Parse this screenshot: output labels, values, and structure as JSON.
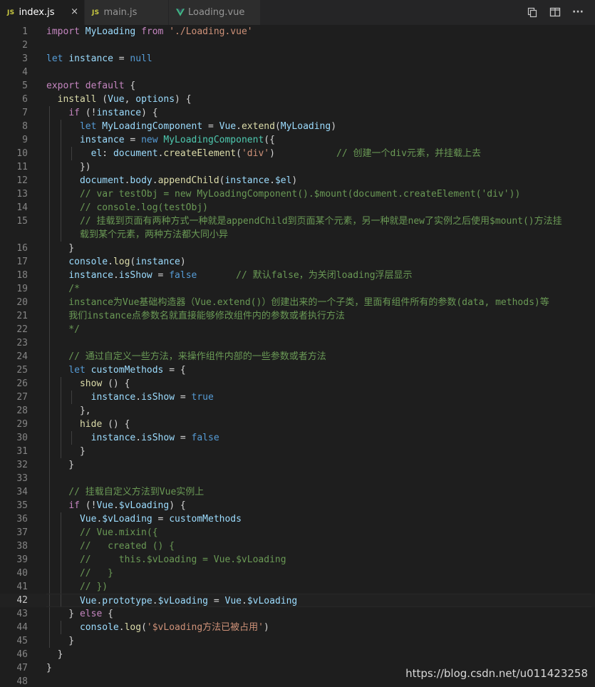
{
  "tabs": [
    {
      "name": "index.js",
      "icon": "js-file-icon",
      "badge": "JS",
      "active": true,
      "close": "×"
    },
    {
      "name": "main.js",
      "icon": "js-file-icon",
      "badge": "JS",
      "active": false
    },
    {
      "name": "Loading.vue",
      "icon": "vue-file-icon",
      "active": false
    }
  ],
  "toolbar": {
    "actions": [
      "open-changes-icon",
      "split-editor-icon",
      "more-actions-icon"
    ],
    "more": "···"
  },
  "editor": {
    "active_line": 42,
    "lines": [
      {
        "n": "1",
        "indent": 0,
        "t": [
          [
            "c",
            "import"
          ],
          [
            "o",
            " "
          ],
          [
            "v",
            "MyLoading"
          ],
          [
            "o",
            " "
          ],
          [
            "c",
            "from"
          ],
          [
            "o",
            " "
          ],
          [
            "s",
            "'./Loading.vue'"
          ]
        ]
      },
      {
        "n": "2",
        "indent": 0,
        "t": []
      },
      {
        "n": "3",
        "indent": 0,
        "t": [
          [
            "k",
            "let"
          ],
          [
            "o",
            " "
          ],
          [
            "v",
            "instance"
          ],
          [
            "o",
            " = "
          ],
          [
            "k",
            "null"
          ]
        ]
      },
      {
        "n": "4",
        "indent": 0,
        "t": []
      },
      {
        "n": "5",
        "indent": 0,
        "t": [
          [
            "c",
            "export"
          ],
          [
            "o",
            " "
          ],
          [
            "c",
            "default"
          ],
          [
            "o",
            " {"
          ]
        ]
      },
      {
        "n": "6",
        "indent": 0,
        "t": [
          [
            "o",
            "  "
          ],
          [
            "f",
            "install"
          ],
          [
            "o",
            " ("
          ],
          [
            "v",
            "Vue"
          ],
          [
            "o",
            ", "
          ],
          [
            "v",
            "options"
          ],
          [
            "o",
            ") {"
          ]
        ]
      },
      {
        "n": "7",
        "indent": 1,
        "t": [
          [
            "o",
            "    "
          ],
          [
            "c",
            "if"
          ],
          [
            "o",
            " (!"
          ],
          [
            "v",
            "instance"
          ],
          [
            "o",
            ") {"
          ]
        ]
      },
      {
        "n": "8",
        "indent": 2,
        "t": [
          [
            "o",
            "      "
          ],
          [
            "k",
            "let"
          ],
          [
            "o",
            " "
          ],
          [
            "v",
            "MyLoadingComponent"
          ],
          [
            "o",
            " = "
          ],
          [
            "v",
            "Vue"
          ],
          [
            "o",
            "."
          ],
          [
            "f",
            "extend"
          ],
          [
            "o",
            "("
          ],
          [
            "v",
            "MyLoading"
          ],
          [
            "o",
            ")"
          ]
        ]
      },
      {
        "n": "9",
        "indent": 2,
        "t": [
          [
            "o",
            "      "
          ],
          [
            "v",
            "instance"
          ],
          [
            "o",
            " = "
          ],
          [
            "k",
            "new"
          ],
          [
            "o",
            " "
          ],
          [
            "t",
            "MyLoadingComponent"
          ],
          [
            "o",
            "({"
          ]
        ]
      },
      {
        "n": "10",
        "indent": 3,
        "t": [
          [
            "o",
            "        "
          ],
          [
            "v",
            "el"
          ],
          [
            "o",
            ": "
          ],
          [
            "v",
            "document"
          ],
          [
            "o",
            "."
          ],
          [
            "f",
            "createElement"
          ],
          [
            "o",
            "("
          ],
          [
            "s",
            "'div'"
          ],
          [
            "o",
            ")"
          ],
          [
            "m",
            "           // 创建一个div元素，并挂载上去"
          ]
        ]
      },
      {
        "n": "11",
        "indent": 2,
        "t": [
          [
            "o",
            "      })"
          ]
        ]
      },
      {
        "n": "12",
        "indent": 2,
        "t": [
          [
            "o",
            "      "
          ],
          [
            "v",
            "document"
          ],
          [
            "o",
            "."
          ],
          [
            "v",
            "body"
          ],
          [
            "o",
            "."
          ],
          [
            "f",
            "appendChild"
          ],
          [
            "o",
            "("
          ],
          [
            "v",
            "instance"
          ],
          [
            "o",
            "."
          ],
          [
            "v",
            "$el"
          ],
          [
            "o",
            ")"
          ]
        ]
      },
      {
        "n": "13",
        "indent": 2,
        "t": [
          [
            "m",
            "      // var testObj = new MyLoadingComponent().$mount(document.createElement('div'))"
          ]
        ]
      },
      {
        "n": "14",
        "indent": 2,
        "t": [
          [
            "m",
            "      // console.log(testObj)"
          ]
        ]
      },
      {
        "n": "15",
        "indent": 2,
        "t": [
          [
            "m",
            "      // 挂载到页面有两种方式一种就是appendChild到页面某个元素，另一种就是new了实例之后使用$mount()方法挂"
          ]
        ]
      },
      {
        "n": "",
        "indent": 2,
        "t": [
          [
            "m",
            "      载到某个元素，两种方法都大同小异"
          ]
        ]
      },
      {
        "n": "16",
        "indent": 1,
        "t": [
          [
            "o",
            "    }"
          ]
        ]
      },
      {
        "n": "17",
        "indent": 1,
        "t": [
          [
            "o",
            "    "
          ],
          [
            "v",
            "console"
          ],
          [
            "o",
            "."
          ],
          [
            "f",
            "log"
          ],
          [
            "o",
            "("
          ],
          [
            "v",
            "instance"
          ],
          [
            "o",
            ")"
          ]
        ]
      },
      {
        "n": "18",
        "indent": 1,
        "t": [
          [
            "o",
            "    "
          ],
          [
            "v",
            "instance"
          ],
          [
            "o",
            "."
          ],
          [
            "v",
            "isShow"
          ],
          [
            "o",
            " = "
          ],
          [
            "k",
            "false"
          ],
          [
            "m",
            "       // 默认false，为关闭loading浮层显示"
          ]
        ]
      },
      {
        "n": "19",
        "indent": 1,
        "t": [
          [
            "m",
            "    /*"
          ]
        ]
      },
      {
        "n": "20",
        "indent": 1,
        "t": [
          [
            "m",
            "    instance为Vue基础构造器（Vue.extend()）创建出来的一个子类，里面有组件所有的参数(data, methods)等"
          ]
        ]
      },
      {
        "n": "21",
        "indent": 1,
        "t": [
          [
            "m",
            "    我们instance点参数名就直接能够修改组件内的参数或者执行方法"
          ]
        ]
      },
      {
        "n": "22",
        "indent": 1,
        "t": [
          [
            "m",
            "    */"
          ]
        ]
      },
      {
        "n": "23",
        "indent": 1,
        "t": []
      },
      {
        "n": "24",
        "indent": 1,
        "t": [
          [
            "m",
            "    // 通过自定义一些方法，来操作组件内部的一些参数或者方法"
          ]
        ]
      },
      {
        "n": "25",
        "indent": 1,
        "t": [
          [
            "o",
            "    "
          ],
          [
            "k",
            "let"
          ],
          [
            "o",
            " "
          ],
          [
            "v",
            "customMethods"
          ],
          [
            "o",
            " = {"
          ]
        ]
      },
      {
        "n": "26",
        "indent": 2,
        "t": [
          [
            "o",
            "      "
          ],
          [
            "f",
            "show"
          ],
          [
            "o",
            " () {"
          ]
        ]
      },
      {
        "n": "27",
        "indent": 3,
        "t": [
          [
            "o",
            "        "
          ],
          [
            "v",
            "instance"
          ],
          [
            "o",
            "."
          ],
          [
            "v",
            "isShow"
          ],
          [
            "o",
            " = "
          ],
          [
            "k",
            "true"
          ]
        ]
      },
      {
        "n": "28",
        "indent": 2,
        "t": [
          [
            "o",
            "      },"
          ]
        ]
      },
      {
        "n": "29",
        "indent": 2,
        "t": [
          [
            "o",
            "      "
          ],
          [
            "f",
            "hide"
          ],
          [
            "o",
            " () {"
          ]
        ]
      },
      {
        "n": "30",
        "indent": 3,
        "t": [
          [
            "o",
            "        "
          ],
          [
            "v",
            "instance"
          ],
          [
            "o",
            "."
          ],
          [
            "v",
            "isShow"
          ],
          [
            "o",
            " = "
          ],
          [
            "k",
            "false"
          ]
        ]
      },
      {
        "n": "31",
        "indent": 2,
        "t": [
          [
            "o",
            "      }"
          ]
        ]
      },
      {
        "n": "32",
        "indent": 1,
        "t": [
          [
            "o",
            "    }"
          ]
        ]
      },
      {
        "n": "33",
        "indent": 1,
        "t": []
      },
      {
        "n": "34",
        "indent": 1,
        "t": [
          [
            "m",
            "    // 挂载自定义方法到Vue实例上"
          ]
        ]
      },
      {
        "n": "35",
        "indent": 1,
        "t": [
          [
            "o",
            "    "
          ],
          [
            "c",
            "if"
          ],
          [
            "o",
            " (!"
          ],
          [
            "v",
            "Vue"
          ],
          [
            "o",
            "."
          ],
          [
            "v",
            "$vLoading"
          ],
          [
            "o",
            ") {"
          ]
        ]
      },
      {
        "n": "36",
        "indent": 2,
        "t": [
          [
            "o",
            "      "
          ],
          [
            "v",
            "Vue"
          ],
          [
            "o",
            "."
          ],
          [
            "v",
            "$vLoading"
          ],
          [
            "o",
            " = "
          ],
          [
            "v",
            "customMethods"
          ]
        ]
      },
      {
        "n": "37",
        "indent": 2,
        "t": [
          [
            "m",
            "      // Vue.mixin({"
          ]
        ]
      },
      {
        "n": "38",
        "indent": 2,
        "t": [
          [
            "m",
            "      //   created () {"
          ]
        ]
      },
      {
        "n": "39",
        "indent": 2,
        "t": [
          [
            "m",
            "      //     this.$vLoading = Vue.$vLoading"
          ]
        ]
      },
      {
        "n": "40",
        "indent": 2,
        "t": [
          [
            "m",
            "      //   }"
          ]
        ]
      },
      {
        "n": "41",
        "indent": 2,
        "t": [
          [
            "m",
            "      // })"
          ]
        ]
      },
      {
        "n": "42",
        "indent": 2,
        "t": [
          [
            "o",
            "      "
          ],
          [
            "v",
            "Vue"
          ],
          [
            "o",
            "."
          ],
          [
            "v",
            "prototype"
          ],
          [
            "o",
            "."
          ],
          [
            "v",
            "$vLoading"
          ],
          [
            "o",
            " = "
          ],
          [
            "v",
            "Vue"
          ],
          [
            "o",
            "."
          ],
          [
            "v",
            "$vLoading"
          ]
        ]
      },
      {
        "n": "43",
        "indent": 1,
        "t": [
          [
            "o",
            "    } "
          ],
          [
            "c",
            "else"
          ],
          [
            "o",
            " {"
          ]
        ]
      },
      {
        "n": "44",
        "indent": 2,
        "t": [
          [
            "o",
            "      "
          ],
          [
            "v",
            "console"
          ],
          [
            "o",
            "."
          ],
          [
            "f",
            "log"
          ],
          [
            "o",
            "("
          ],
          [
            "s",
            "'$vLoading方法已被占用'"
          ],
          [
            "o",
            ")"
          ]
        ]
      },
      {
        "n": "45",
        "indent": 1,
        "t": [
          [
            "o",
            "    }"
          ]
        ]
      },
      {
        "n": "46",
        "indent": 0,
        "t": [
          [
            "o",
            "  }"
          ]
        ]
      },
      {
        "n": "47",
        "indent": 0,
        "t": [
          [
            "o",
            "}"
          ]
        ]
      },
      {
        "n": "48",
        "indent": 0,
        "t": []
      }
    ]
  },
  "watermark": "https://blog.csdn.net/u011423258",
  "colors": {
    "background": "#1e1e1e",
    "tabbar": "#252526",
    "keyword": "#569cd6",
    "control": "#c586c0",
    "variable": "#9cdcfe",
    "function": "#dcdcaa",
    "class": "#4ec9b0",
    "string": "#ce9178",
    "comment": "#6a9955"
  }
}
